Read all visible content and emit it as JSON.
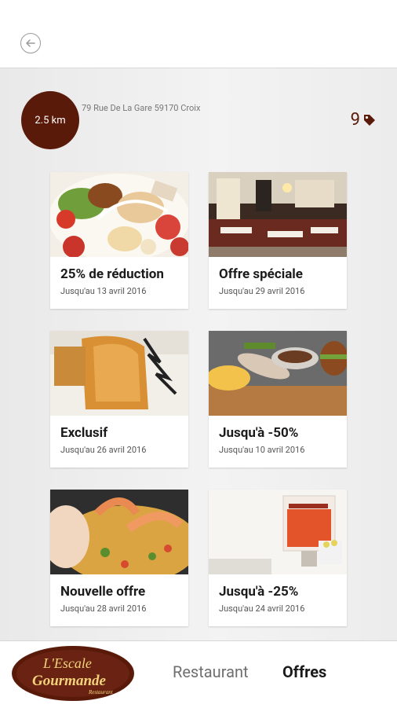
{
  "header": {
    "back_icon": "arrow-left-icon"
  },
  "restaurant": {
    "distance": "2.5 km",
    "address": "79 Rue De La Gare 59170 Croix",
    "offer_count": "9",
    "offer_icon": "tag-icon",
    "accent_color": "#5a1a0a"
  },
  "offers": [
    {
      "title": "25% de réduction",
      "date": "Jusqu'au 13 avril 2016"
    },
    {
      "title": "Offre spéciale",
      "date": "Jusqu'au 29 avril 2016"
    },
    {
      "title": "Exclusif",
      "date": "Jusqu'au 26 avril 2016"
    },
    {
      "title": "Jusqu'à -50%",
      "date": "Jusqu'au 10 avril 2016"
    },
    {
      "title": "Nouvelle offre",
      "date": "Jusqu'au 28 avril 2016"
    },
    {
      "title": "Jusqu'à -25%",
      "date": "Jusqu'au 24 avril 2016"
    }
  ],
  "bottom_nav": {
    "logo_line1": "L'Escale",
    "logo_line2": "Gourmande",
    "logo_line3": "Restaurant",
    "tabs": [
      {
        "label": "Restaurant",
        "active": false
      },
      {
        "label": "Offres",
        "active": true
      }
    ]
  }
}
